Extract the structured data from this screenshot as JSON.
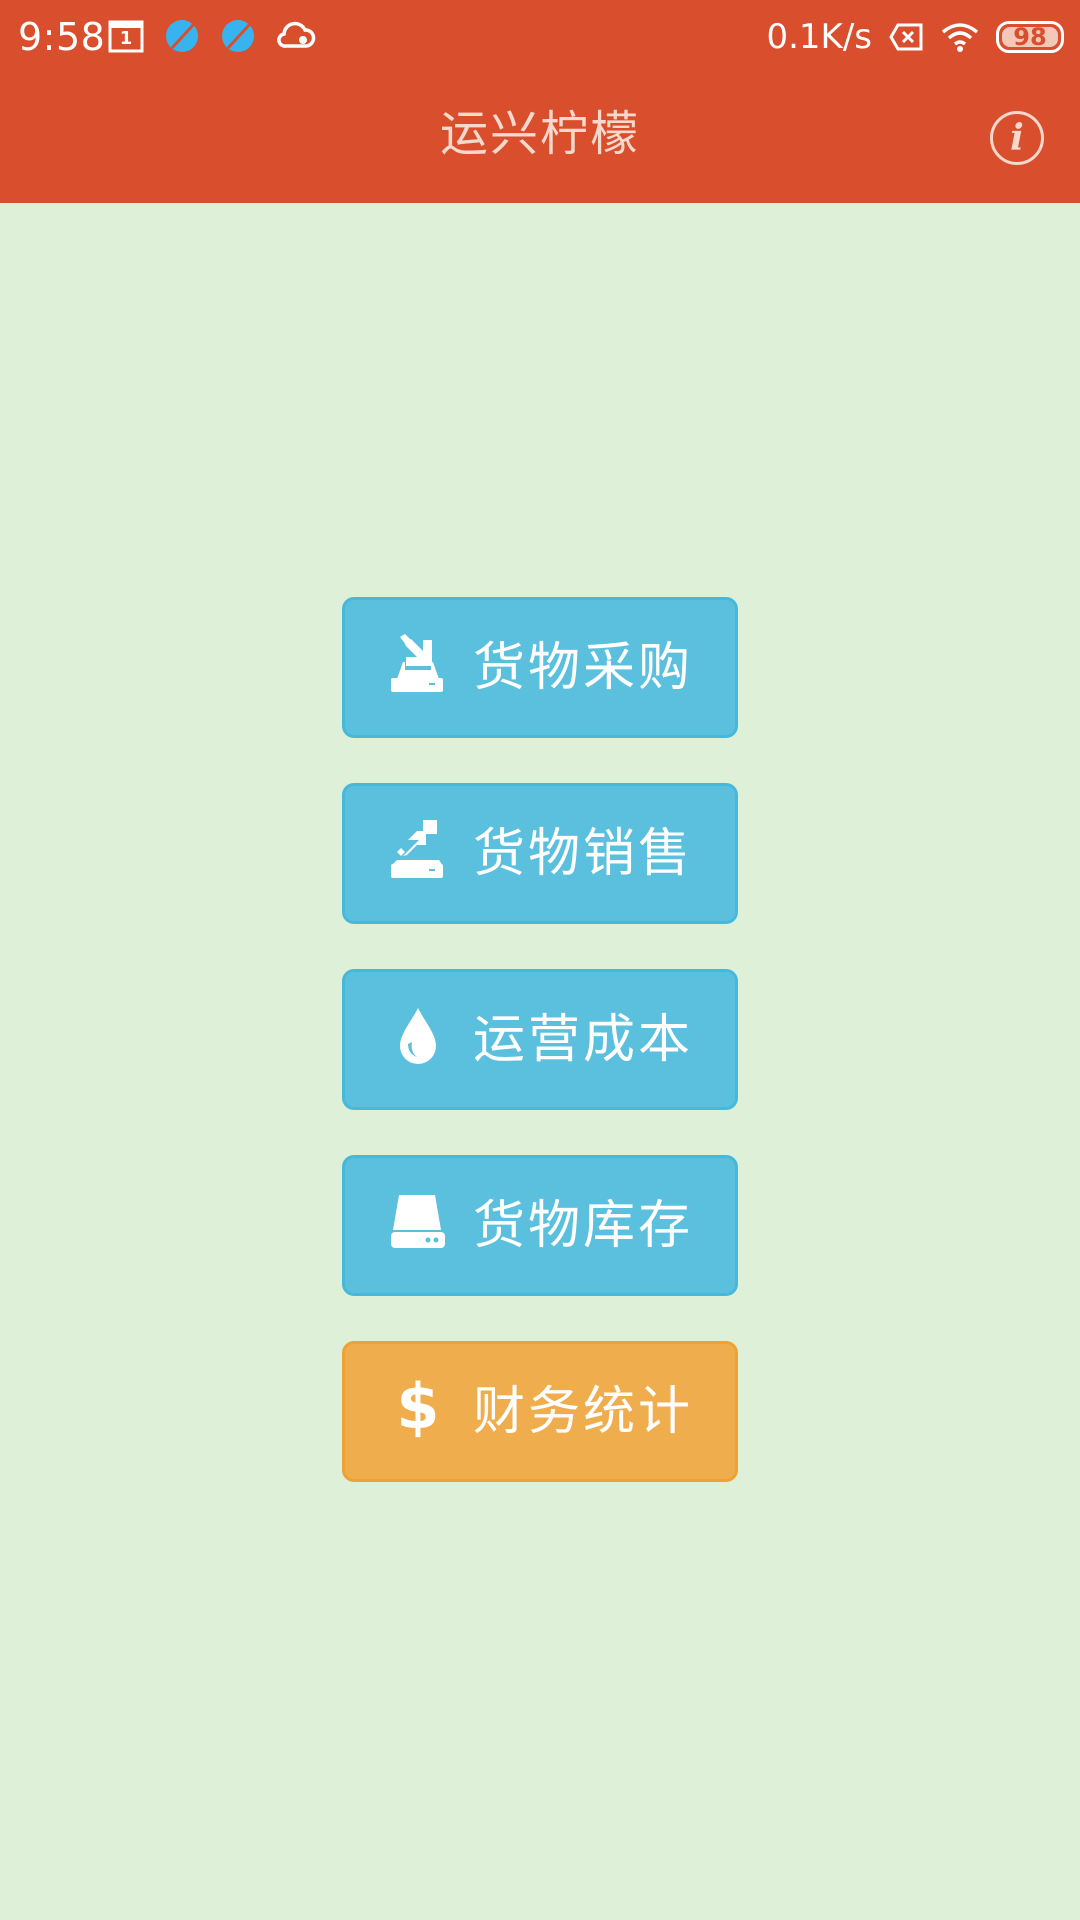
{
  "status_bar": {
    "time": "9:58",
    "net_speed": "0.1K/s",
    "battery": "98",
    "calendar_day": "1"
  },
  "app_bar": {
    "title": "运兴柠檬",
    "info_glyph": "i"
  },
  "menu": {
    "items": [
      {
        "label": "货物采购",
        "icon": "inbox-download-icon",
        "style": "info"
      },
      {
        "label": "货物销售",
        "icon": "inbox-upload-icon",
        "style": "info"
      },
      {
        "label": "运营成本",
        "icon": "drop-icon",
        "style": "info"
      },
      {
        "label": "货物库存",
        "icon": "hard-drive-icon",
        "style": "info"
      },
      {
        "label": "财务统计",
        "icon": "dollar-icon",
        "icon_glyph": "$",
        "style": "warning"
      }
    ]
  },
  "colors": {
    "app_bar": "#d94e2c",
    "background": "#dff0d8",
    "button_info": "#5bc0de",
    "button_warning": "#f0ad4e"
  }
}
